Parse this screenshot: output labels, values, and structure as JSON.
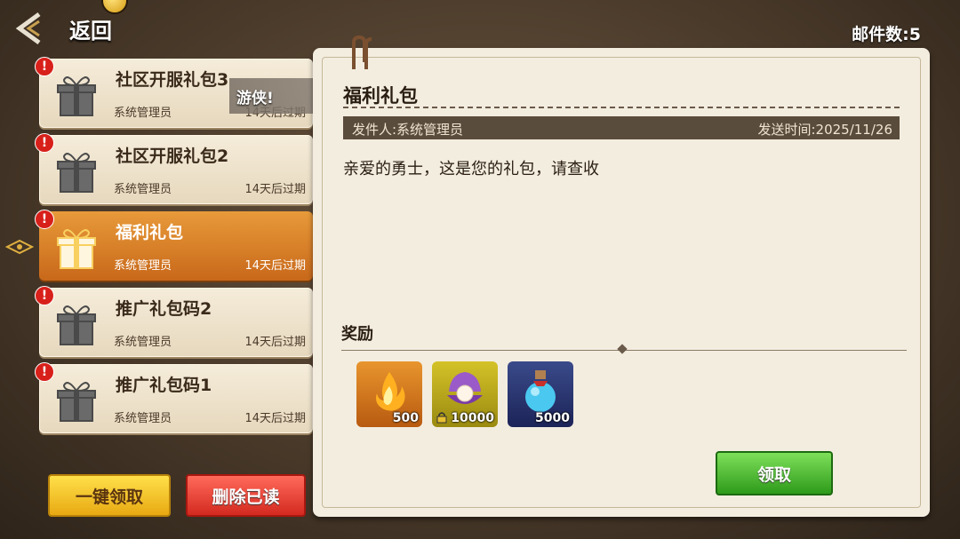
{
  "header": {
    "back_label": "返回",
    "mail_count": "邮件数:5"
  },
  "mails": [
    {
      "title": "社区开服礼包3",
      "sender": "系统管理员",
      "expire": "14天后过期",
      "unread": "!"
    },
    {
      "title": "社区开服礼包2",
      "sender": "系统管理员",
      "expire": "14天后过期",
      "unread": "!"
    },
    {
      "title": "福利礼包",
      "sender": "系统管理员",
      "expire": "14天后过期",
      "unread": "!"
    },
    {
      "title": "推广礼包码2",
      "sender": "系统管理员",
      "expire": "14天后过期",
      "unread": "!"
    },
    {
      "title": "推广礼包码1",
      "sender": "系统管理员",
      "expire": "14天后过期",
      "unread": "!"
    }
  ],
  "selected_index": 2,
  "banner_text": "游侠!",
  "buttons": {
    "claim_all": "一键领取",
    "delete_read": "删除已读",
    "claim": "领取"
  },
  "detail": {
    "title": "福利礼包",
    "sender": "发件人:系统管理员",
    "sent_time": "发送时间:2025/11/26",
    "body": "亲爱的勇士，这是您的礼包，请查收",
    "reward_label": "奖励",
    "rewards": [
      {
        "icon": "flame-icon",
        "qty": "500"
      },
      {
        "icon": "pearl-shell-icon",
        "qty": "10000",
        "locked": true
      },
      {
        "icon": "potion-bottle-icon",
        "qty": "5000"
      }
    ]
  }
}
